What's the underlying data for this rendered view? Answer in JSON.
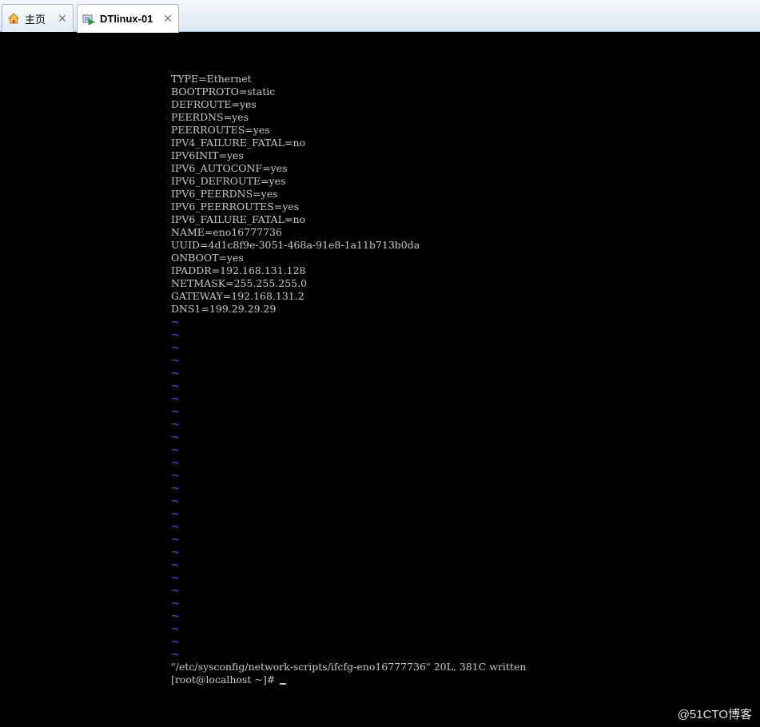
{
  "tabs": [
    {
      "label": "主页",
      "icon": "home-icon"
    },
    {
      "label": "DTlinux-01",
      "icon": "vm-running-icon"
    }
  ],
  "close_glyph": "✕",
  "terminal": {
    "lines": [
      "TYPE=Ethernet",
      "BOOTPROTO=static",
      "DEFROUTE=yes",
      "PEERDNS=yes",
      "PEERROUTES=yes",
      "IPV4_FAILURE_FATAL=no",
      "IPV6INIT=yes",
      "IPV6_AUTOCONF=yes",
      "IPV6_DEFROUTE=yes",
      "IPV6_PEERDNS=yes",
      "IPV6_PEERROUTES=yes",
      "IPV6_FAILURE_FATAL=no",
      "NAME=eno16777736",
      "UUID=4d1c8f9e-3051-468a-91e8-1a11b713b0da",
      "ONBOOT=yes",
      "IPADDR=192.168.131.128",
      "NETMASK=255.255.255.0",
      "GATEWAY=192.168.131.2",
      "DNS1=199.29.29.29"
    ],
    "tilde": "~",
    "status_line": "\"/etc/sysconfig/network-scripts/ifcfg-eno16777736\" 20L, 381C written",
    "prompt": "[root@localhost ~]#",
    "tilde_color": "#3b6bff"
  },
  "watermark": "@51CTO博客"
}
